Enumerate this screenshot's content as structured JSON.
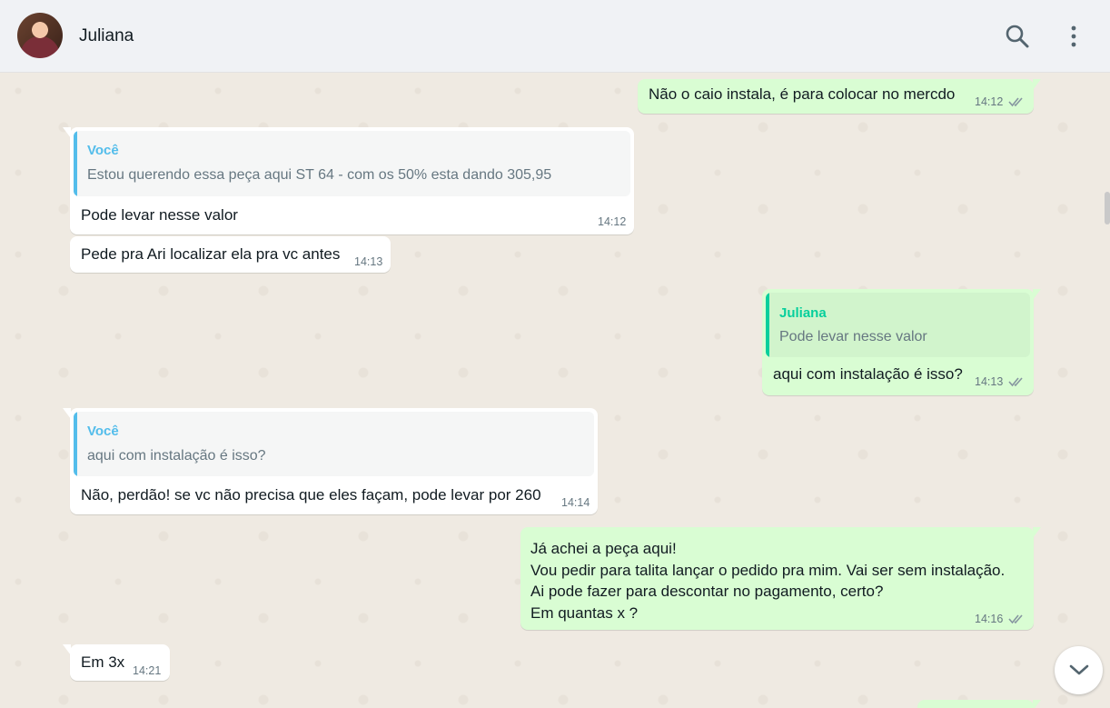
{
  "header": {
    "contact_name": "Juliana",
    "icons": {
      "search": "search-icon",
      "menu": "menu-dots-icon",
      "avatar": "contact-avatar"
    }
  },
  "messages": [
    {
      "dir": "out",
      "text": "Não o caio instala, é para colocar no mercdo",
      "time": "14:12",
      "status": "read"
    },
    {
      "dir": "in",
      "quote_author": "Você",
      "quote_text": "Estou querendo essa peça aqui ST 64 - com os 50% esta dando 305,95",
      "text": "Pode levar nesse valor",
      "time": "14:12"
    },
    {
      "dir": "in",
      "text": "Pede pra Ari localizar ela pra vc antes",
      "time": "14:13"
    },
    {
      "dir": "out",
      "quote_author": "Juliana",
      "quote_text": "Pode levar nesse valor",
      "text": "aqui com instalação é isso?",
      "time": "14:13",
      "status": "read"
    },
    {
      "dir": "in",
      "quote_author": "Você",
      "quote_text": "aqui com instalação é isso?",
      "text": "Não, perdão! se vc não precisa que eles façam, pode levar por 260",
      "time": "14:14"
    },
    {
      "dir": "out",
      "text": "Já achei a peça aqui!\nVou pedir para talita lançar o pedido pra mim. Vai ser sem instalação.\nAi pode fazer para descontar no pagamento, certo?\nEm quantas x ?",
      "time": "14:16",
      "status": "read"
    },
    {
      "dir": "in",
      "text": "Em 3x",
      "time": "14:21"
    }
  ],
  "colors": {
    "quote_in": "#53bdeb",
    "quote_out": "#06cf9c",
    "read_check": "#8696a0",
    "bubble_out": "#d9fdd3"
  }
}
